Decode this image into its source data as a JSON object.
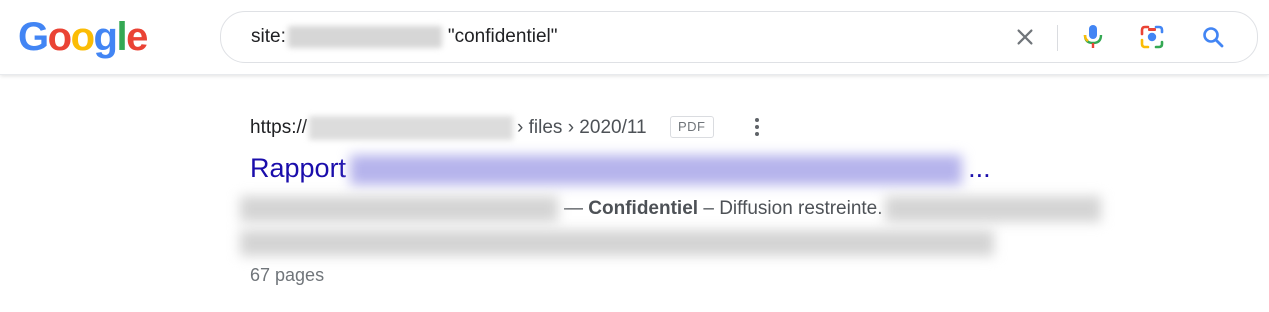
{
  "logo": {
    "letters": [
      "G",
      "o",
      "o",
      "g",
      "l",
      "e"
    ],
    "colors": [
      "#4285F4",
      "#EA4335",
      "#FBBC05",
      "#4285F4",
      "#34A853",
      "#EA4335"
    ]
  },
  "search": {
    "operator": "site:",
    "term": "\"confidentiel\"",
    "clear_icon": "close-icon",
    "voice_icon": "microphone-icon",
    "lens_icon": "camera-lens-icon",
    "search_icon": "search-icon"
  },
  "result": {
    "url_prefix": "https://",
    "breadcrumb": "› files › 2020/11",
    "badge": "PDF",
    "title_start": "Rapport",
    "title_end": "...",
    "snippet_dash": "—",
    "snippet_bold": "Confidentiel",
    "snippet_rest": "– Diffusion restreinte.",
    "pages": "67 pages"
  },
  "colors": {
    "link": "#1a0dab",
    "text": "#4d5156",
    "muted": "#70757a"
  }
}
